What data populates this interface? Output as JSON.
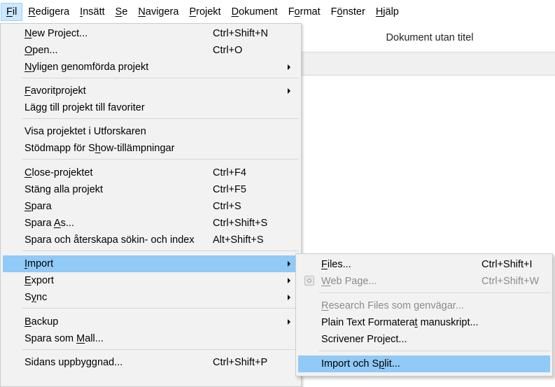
{
  "menubar": {
    "items": [
      {
        "label": "Fil",
        "mn": "F",
        "rest": "il"
      },
      {
        "label": "Redigera",
        "mn": "R",
        "rest": "edigera"
      },
      {
        "label": "Insätt",
        "mn": "I",
        "rest": "nsätt"
      },
      {
        "label": "Se",
        "mn": "S",
        "rest": "e"
      },
      {
        "label": "Navigera",
        "mn": "N",
        "rest": "avigera"
      },
      {
        "label": "Projekt",
        "mn": "P",
        "rest": "rojekt"
      },
      {
        "label": "Dokument",
        "mn": "D",
        "rest": "okument"
      },
      {
        "label": "Format",
        "mn": "o",
        "pre": "F",
        "rest": "rmat"
      },
      {
        "label": "Fönster",
        "mn": "ö",
        "pre": "F",
        "rest": "nster"
      },
      {
        "label": "Hjälp",
        "mn": "H",
        "rest": "jälp"
      }
    ]
  },
  "document": {
    "title": "Dokument utan titel"
  },
  "file_menu": {
    "items": [
      {
        "pre": "",
        "mn": "N",
        "post": "ew Project...",
        "shortcut": "Ctrl+Shift+N"
      },
      {
        "pre": "",
        "mn": "O",
        "post": "pen...",
        "shortcut": "Ctrl+O"
      },
      {
        "pre": "",
        "mn": "N",
        "post": "yligen genomförda projekt",
        "shortcut": ""
      },
      {
        "pre": "",
        "mn": "F",
        "post": "avoritprojekt",
        "shortcut": ""
      },
      {
        "pre": "Lägg till projekt till favoriter",
        "mn": "",
        "post": "",
        "shortcut": ""
      },
      {
        "pre": "Visa projektet i Utforskaren",
        "mn": "",
        "post": "",
        "shortcut": ""
      },
      {
        "pre": "Stödmapp för S",
        "mn": "h",
        "post": "ow-tillämpningar",
        "shortcut": ""
      },
      {
        "pre": "",
        "mn": "C",
        "post": "lose-projektet",
        "shortcut": "Ctrl+F4"
      },
      {
        "pre": "Stäng alla projekt",
        "mn": "",
        "post": "",
        "shortcut": "Ctrl+F5"
      },
      {
        "pre": "",
        "mn": "S",
        "post": "para",
        "shortcut": "Ctrl+S"
      },
      {
        "pre": "Spara ",
        "mn": "A",
        "post": "s...",
        "shortcut": "Ctrl+Shift+S"
      },
      {
        "pre": "Spara och återskapa sökin- och index",
        "mn": "",
        "post": "",
        "shortcut": "Alt+Shift+S"
      },
      {
        "pre": "",
        "mn": "I",
        "post": "mport",
        "shortcut": ""
      },
      {
        "pre": "",
        "mn": "E",
        "post": "xport",
        "shortcut": ""
      },
      {
        "pre": "S",
        "mn": "y",
        "post": "nc",
        "shortcut": ""
      },
      {
        "pre": "",
        "mn": "B",
        "post": "ackup",
        "shortcut": ""
      },
      {
        "pre": "Spara som ",
        "mn": "M",
        "post": "all...",
        "shortcut": ""
      },
      {
        "pre": "Sidans uppbyggnad...",
        "mn": "",
        "post": "",
        "shortcut": "Ctrl+Shift+P"
      }
    ]
  },
  "import_menu": {
    "items": [
      {
        "pre": "",
        "mn": "F",
        "post": "iles...",
        "shortcut": "Ctrl+Shift+I"
      },
      {
        "pre": "",
        "mn": "W",
        "post": "eb Page...",
        "shortcut": "Ctrl+Shift+W"
      },
      {
        "pre": "",
        "mn": "R",
        "post": "esearch Files som genvägar...",
        "shortcut": ""
      },
      {
        "pre": "Plain Text Formatera",
        "mn": "t",
        "post": " manuskript...",
        "shortcut": ""
      },
      {
        "pre": "Scrivener Pro",
        "mn": "j",
        "post": "ect...",
        "shortcut": ""
      },
      {
        "pre": "Import och S",
        "mn": "p",
        "post": "lit...",
        "shortcut": ""
      }
    ]
  },
  "icons": {
    "web_page": "web-page-icon",
    "submenu": "submenu-arrow-icon"
  },
  "colors": {
    "menu_bg": "#f2f2f2",
    "highlight": "#91c9f7",
    "active_menubar": "#cce8ff",
    "disabled_text": "#8c8c8c"
  }
}
